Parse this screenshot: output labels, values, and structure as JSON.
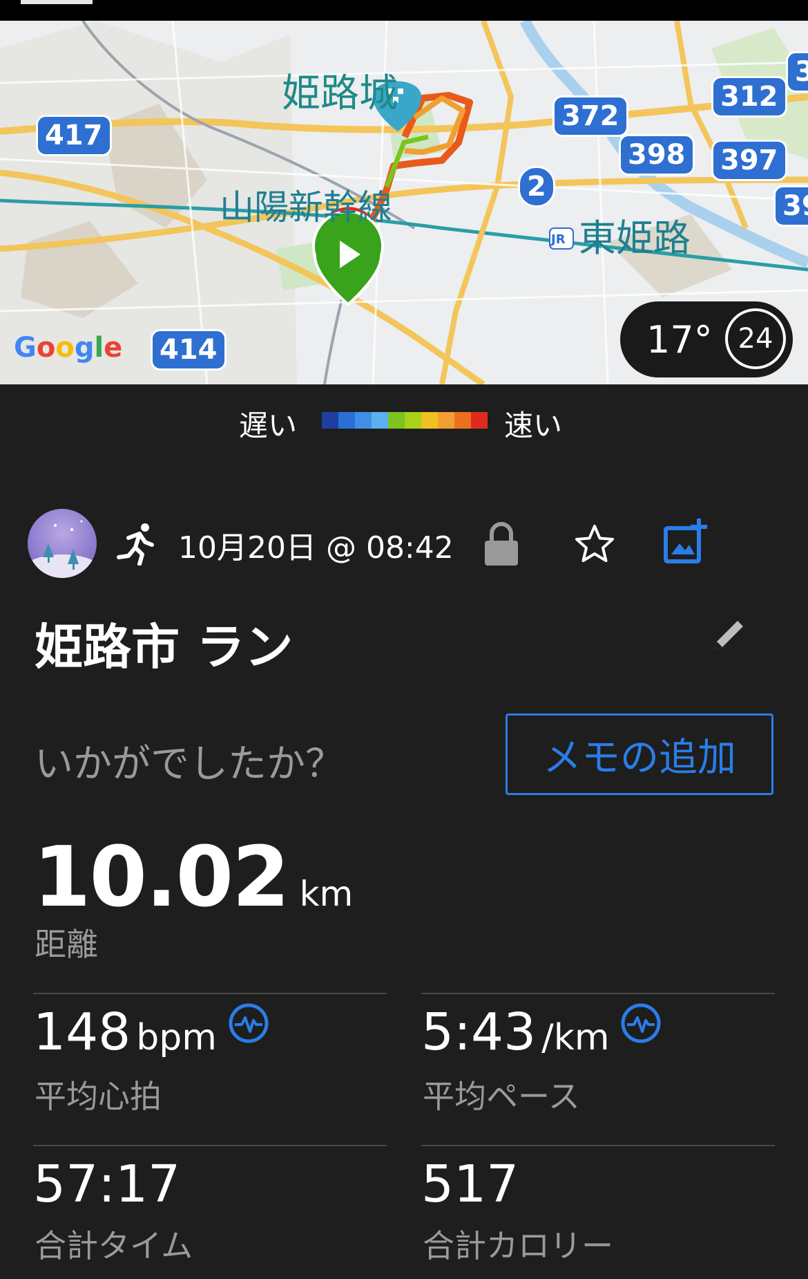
{
  "map": {
    "place_castle": "姫路城",
    "line_shinkansen": "山陽新幹線",
    "station": "東姫路",
    "jr_badge": "JR",
    "routes": [
      "417",
      "372",
      "312",
      "3",
      "398",
      "397",
      "2",
      "39",
      "414"
    ],
    "google_letters": [
      "G",
      "o",
      "o",
      "g",
      "l",
      "e"
    ],
    "weather": {
      "temp": "17°",
      "aqi": "24"
    }
  },
  "legend": {
    "slow": "遅い",
    "fast": "速い",
    "colors": [
      "#1f3fa0",
      "#2a6fd6",
      "#3f8fe6",
      "#5cb0ee",
      "#7cc41e",
      "#a8d21a",
      "#f0c020",
      "#f0a030",
      "#ec7020",
      "#e02a20"
    ]
  },
  "activity": {
    "date": "10月20日 @ 08:42",
    "title": "姫路市 ラン",
    "question": "いかがでしたか？",
    "memo_button": "メモの追加",
    "accent": "#2b7de9"
  },
  "stats": {
    "distance": {
      "value": "10.02",
      "unit": "km",
      "label": "距離"
    },
    "heart_rate": {
      "value": "148",
      "unit": "bpm",
      "label": "平均心拍"
    },
    "pace": {
      "value": "5:43",
      "unit": "/km",
      "label": "平均ペース"
    },
    "time": {
      "value": "57:17",
      "label": "合計タイム"
    },
    "calories": {
      "value": "517",
      "label": "合計カロリー"
    }
  }
}
